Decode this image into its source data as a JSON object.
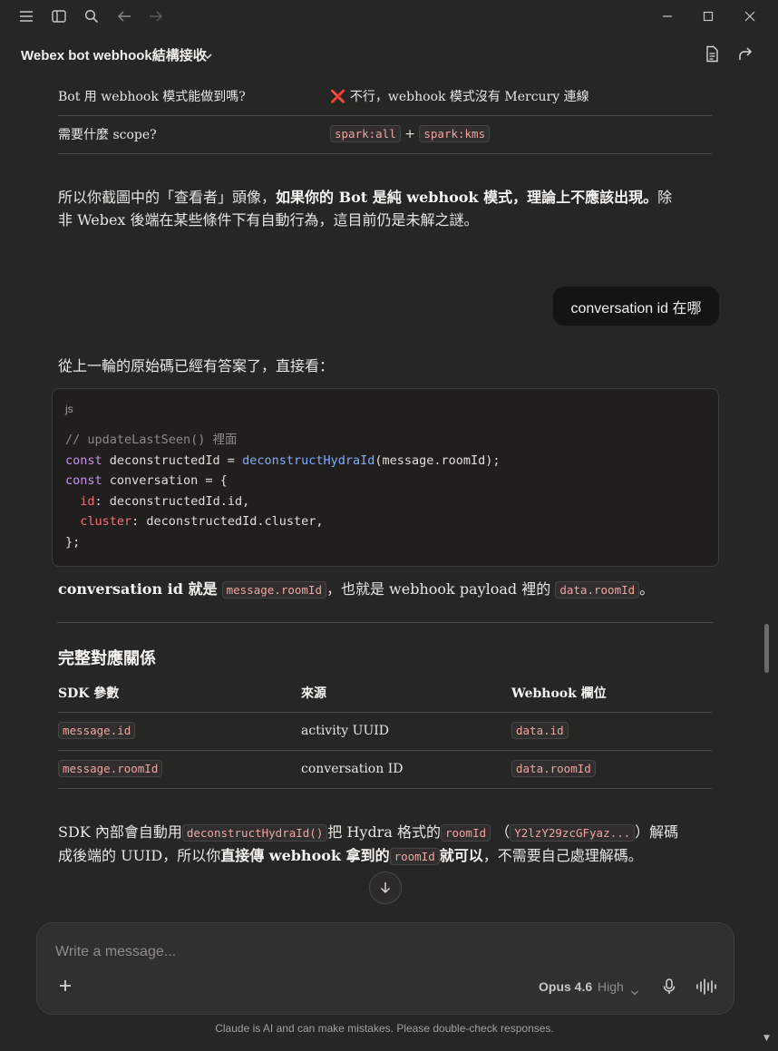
{
  "header": {
    "title": "Webex bot webhook結構接收"
  },
  "top_table": {
    "rows": [
      {
        "label": "Bot 用 webhook 模式能做到嗎?",
        "mark": "❌",
        "value": "不行，webhook 模式沒有 Mercury 連線"
      },
      {
        "label": "需要什麼 scope?",
        "code_a": "spark:all",
        "plus": "+",
        "code_b": "spark:kms"
      }
    ]
  },
  "para1": {
    "pre": "所以你截圖中的「查看者」頭像，",
    "bold": "如果你的 Bot 是純 webhook 模式，理論上不應該出現。",
    "post": "除非 Webex 後端在某些條件下有自動行為，這目前仍是未解之謎。"
  },
  "user_message": "conversation id 在哪",
  "intro": "從上一輪的原始碼已經有答案了，直接看：",
  "code": {
    "lang": "js",
    "comment": "// updateLastSeen() 裡面",
    "kw_const": "const",
    "line2_var": " deconstructedId = ",
    "line2_fn": "deconstructHydraId",
    "line2_rest": "(message.roomId);",
    "line3_rest": " conversation = {",
    "prop_id": "id",
    "line4_rest": ": deconstructedId.id,",
    "prop_cluster": "cluster",
    "line5_rest": ": deconstructedId.cluster,",
    "line6": "};"
  },
  "answer": {
    "bold": "conversation id 就是",
    "code1": "message.roomId",
    "mid": "，也就是 webhook payload 裡的",
    "code2": "data.roomId",
    "end": "。"
  },
  "section_title": "完整對應關係",
  "mapping_table": {
    "headers": [
      "SDK 參數",
      "來源",
      "Webhook 欄位"
    ],
    "rows": [
      [
        "message.id",
        "activity UUID",
        "data.id"
      ],
      [
        "message.roomId",
        "conversation ID",
        "data.roomId"
      ]
    ]
  },
  "para2": {
    "t1": "SDK 內部會自動用",
    "c1": "deconstructHydraId()",
    "t2": "把 Hydra 格式的",
    "c2": "roomId",
    "t3": "（",
    "c3": "Y2lzY29zcGFyaz...",
    "t4": "）解碼成後端的 UUID，所以你",
    "b1": "直接傳 webhook 拿到的",
    "c4": "roomId",
    "b2": "就可以",
    "t5": "，不需要自己處理解碼。"
  },
  "composer": {
    "placeholder": "Write a message...",
    "model": "Opus 4.6",
    "effort": "High"
  },
  "disclaimer": "Claude is AI and can make mistakes. Please double-check responses.",
  "icons": {
    "menu": "menu-icon",
    "sidebar": "sidebar-icon",
    "search": "search-icon",
    "back": "arrow-left-icon",
    "forward": "arrow-right-icon",
    "minimize": "minimize-icon",
    "maximize": "maximize-icon",
    "close": "close-icon",
    "document": "document-icon",
    "share": "share-icon",
    "plus": "plus-icon",
    "mic": "mic-icon",
    "voice": "voice-waveform-icon",
    "scroll_down": "arrow-down-icon"
  }
}
